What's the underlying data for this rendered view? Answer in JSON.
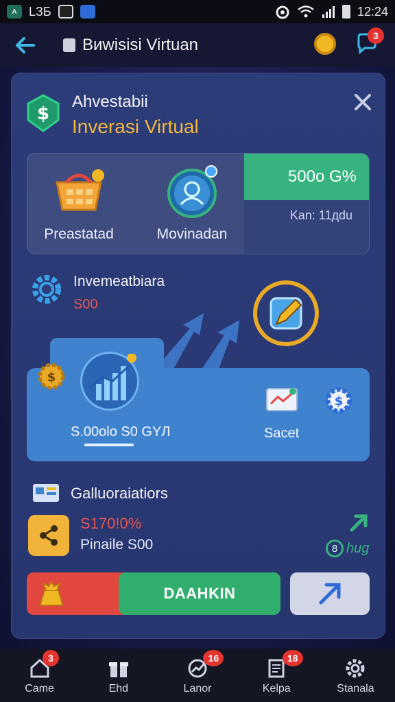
{
  "status_bar": {
    "left_text": "LЗБ",
    "time": "12:24"
  },
  "app_bar": {
    "title": "Bиwisisi Virtuan",
    "chat_badge": "3"
  },
  "card": {
    "title": "Ahvestabii",
    "subtitle": "Inverasi Virtual",
    "stats": {
      "item1_label": "Preastatad",
      "item2_label": "Movinadan",
      "highlight_value": "500o G%",
      "highlight_sub": "Kan: 11дdu"
    },
    "investment": {
      "title": "Invemeatbiara",
      "amount": "S00",
      "chart_value": "S.00olo S0 GYЛ",
      "report_label": "Sacet"
    },
    "collaborations": {
      "title": "Galluoraiatiors",
      "percent": "S170!0%",
      "line": "Pinaile S00",
      "hug_num": "8",
      "hug_label": "hug"
    },
    "action": {
      "primary_label": "DAAHKIN"
    }
  },
  "bottom_nav": {
    "items": [
      {
        "label": "Came",
        "badge": "3"
      },
      {
        "label": "Ehd",
        "badge": ""
      },
      {
        "label": "Lanor",
        "badge": "16"
      },
      {
        "label": "Kelpa",
        "badge": "18"
      },
      {
        "label": "Stanala",
        "badge": ""
      }
    ]
  },
  "colors": {
    "accent_gold": "#f3b73a",
    "accent_green": "#36b37e",
    "accent_red": "#e2483f",
    "panel_blue": "#3f83cf",
    "card_bg": "#2c3c79"
  }
}
